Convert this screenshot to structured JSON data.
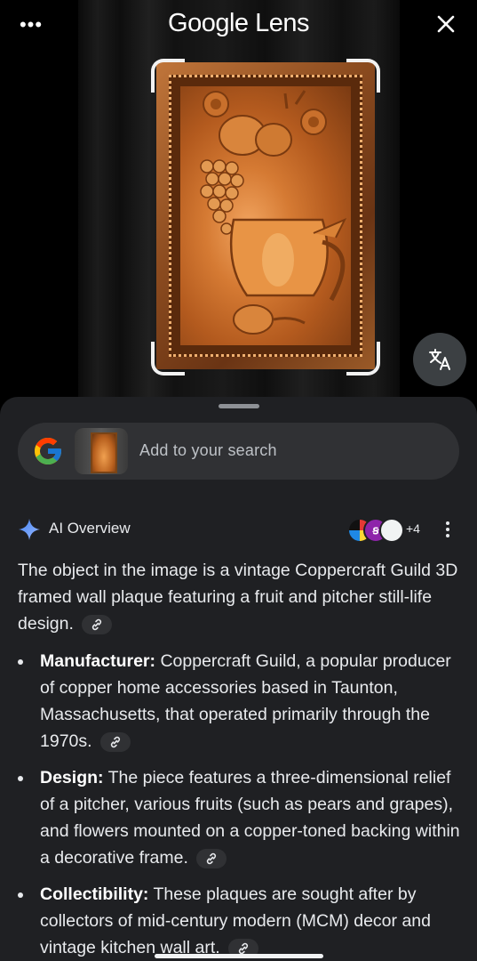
{
  "header": {
    "title": "Google Lens",
    "menu_glyph": "•••",
    "close_icon": "close-icon"
  },
  "camera": {
    "subject": "copper framed wall plaque",
    "translate_icon": "translate-icon"
  },
  "search": {
    "placeholder": "Add to your search",
    "logo_icon": "google-g-icon"
  },
  "ai_overview": {
    "title": "AI Overview",
    "sources_more": "+4",
    "intro": "The object in the image is a vintage Coppercraft Guild 3D framed wall plaque featuring a fruit and pitcher still-life design.",
    "bullets": [
      {
        "label": "Manufacturer:",
        "text": "Coppercraft Guild, a popular producer of copper home accessories based in Taunton, Massachusetts, that operated primarily through the 1970s."
      },
      {
        "label": "Design:",
        "text": "The piece features a three-dimensional relief of a pitcher, various fruits (such as pears and grapes), and flowers mounted on a copper-toned backing within a decorative frame."
      },
      {
        "label": "Collectibility:",
        "text": "These plaques are sought after by collectors of mid-century modern (MCM) decor and vintage kitchen wall art."
      }
    ]
  },
  "colors": {
    "sheet_bg": "#1f2023",
    "pill_bg": "#303134",
    "text": "#e8eaed",
    "accent_blue": "#4285f4"
  }
}
